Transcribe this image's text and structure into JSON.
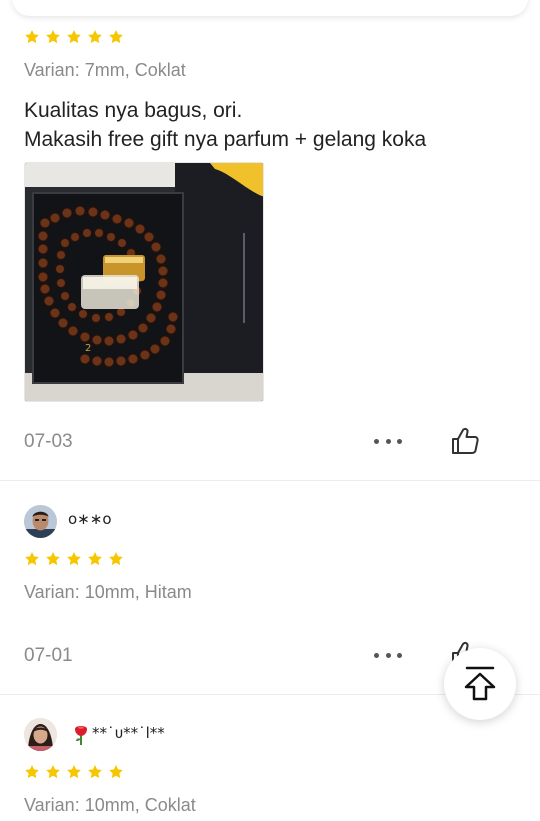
{
  "reviews": [
    {
      "rating": 5,
      "variant": "Varian: 7mm, Coklat",
      "text_lines": [
        "Kualitas nya bagus, ori.",
        "Makasih free gift nya parfum + gelang koka"
      ],
      "date": "07-03"
    },
    {
      "username": "o∗∗o",
      "rating": 5,
      "variant": "Varian: 10mm, Hitam",
      "date": "07-01"
    },
    {
      "username": "**˙ᴜ**˙l**",
      "rating": 5,
      "variant": "Varian: 10mm, Coklat"
    }
  ],
  "colors": {
    "star": "#F6C700",
    "muted_text": "#8a8a8a",
    "divider": "#ececec"
  },
  "icons": [
    "star-icon",
    "more-icon",
    "thumbs-up-icon",
    "rose-icon",
    "scroll-to-top-icon"
  ]
}
